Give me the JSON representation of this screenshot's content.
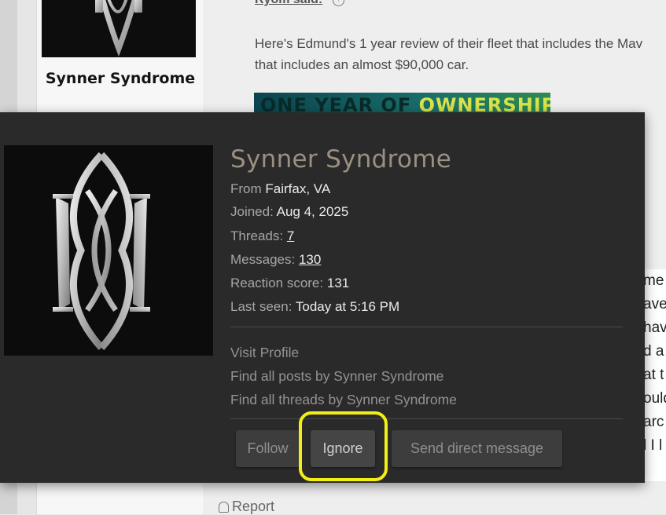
{
  "background_post": {
    "user_name": "Synner Syndrome",
    "quote_author": "Ryom said:",
    "quote_lines": [
      "Here's Edmund's 1 year review of their fleet that includes the Mav",
      "that includes an almost $90,000 car."
    ],
    "thumbnail_text_a": "ONE YEAR OF ",
    "thumbnail_text_b": "OWNERSHIP",
    "body_fragments": [
      "me",
      "ave",
      "have",
      "d a",
      "at t",
      "ould",
      "arc",
      "l I l"
    ],
    "report_label": "Report"
  },
  "member_card": {
    "name": "Synner Syndrome",
    "from_label": "From",
    "from_value": "Fairfax, VA",
    "joined_label": "Joined:",
    "joined_value": "Aug 4, 2025",
    "threads_label": "Threads:",
    "threads_value": "7",
    "messages_label": "Messages:",
    "messages_value": "130",
    "reaction_label": "Reaction score:",
    "reaction_value": "131",
    "last_seen_label": "Last seen:",
    "last_seen_value": "Today at 5:16 PM",
    "links": {
      "visit_profile": "Visit Profile",
      "find_posts": "Find all posts by Synner Syndrome",
      "find_threads": "Find all threads by Synner Syndrome"
    },
    "buttons": {
      "follow": "Follow",
      "ignore": "Ignore",
      "send_dm": "Send direct message"
    }
  },
  "colors": {
    "card_bg": "#2a2a2a",
    "name_color": "#9b8f80",
    "highlight": "#f4ee16"
  },
  "icons": {
    "quote_expand": "arrow-up-circle-icon",
    "report": "bell-icon",
    "avatar": "emblem-logo-icon"
  }
}
